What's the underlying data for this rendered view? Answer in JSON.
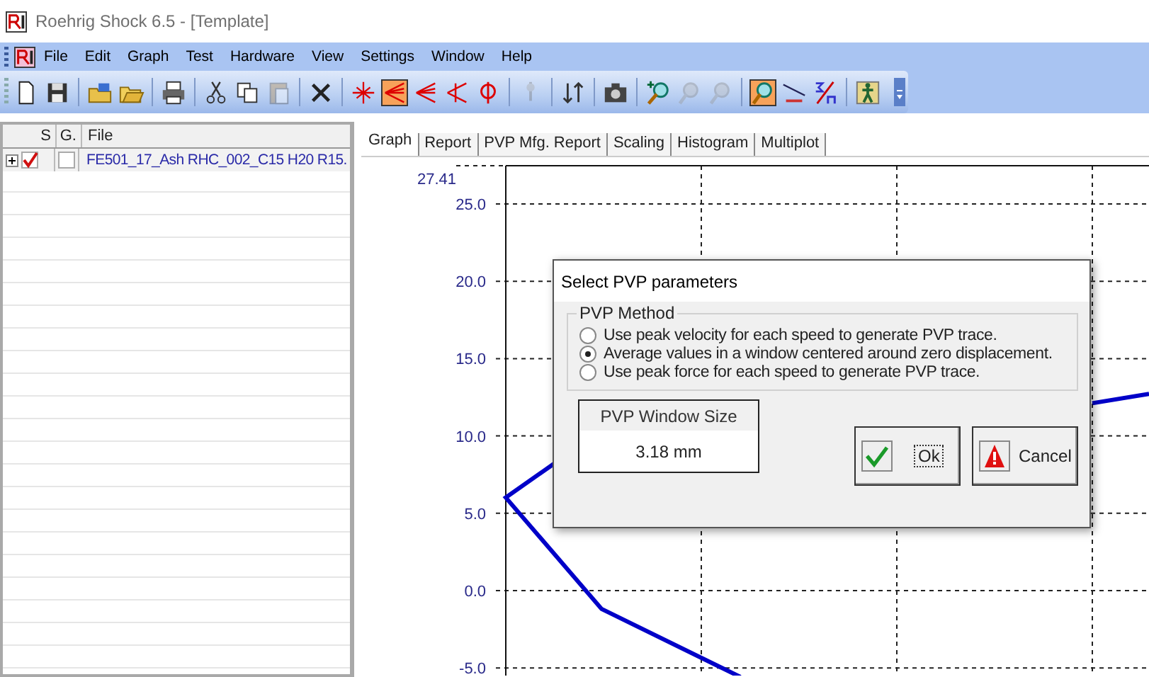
{
  "window": {
    "title": "Roehrig Shock 6.5 - [Template]"
  },
  "menu": [
    "File",
    "Edit",
    "Graph",
    "Test",
    "Hardware",
    "View",
    "Settings",
    "Window",
    "Help"
  ],
  "toolbar": [
    {
      "buttons": [
        {
          "kind": "new",
          "selected": false,
          "disabled": false
        },
        {
          "kind": "save",
          "selected": false,
          "disabled": false
        }
      ]
    },
    {
      "buttons": [
        {
          "kind": "open-database",
          "selected": false,
          "disabled": false
        },
        {
          "kind": "open-folder",
          "selected": false,
          "disabled": false
        }
      ]
    },
    {
      "buttons": [
        {
          "kind": "print",
          "selected": false,
          "disabled": false
        }
      ]
    },
    {
      "buttons": [
        {
          "kind": "cut",
          "selected": false,
          "disabled": false
        },
        {
          "kind": "copy",
          "selected": false,
          "disabled": false
        },
        {
          "kind": "paste",
          "selected": false,
          "disabled": true
        }
      ]
    },
    {
      "buttons": [
        {
          "kind": "delete",
          "selected": false,
          "disabled": false
        }
      ]
    },
    {
      "buttons": [
        {
          "kind": "crosshair",
          "selected": false,
          "disabled": false
        },
        {
          "kind": "lines-box",
          "selected": true,
          "disabled": false
        },
        {
          "kind": "lines-left",
          "selected": false,
          "disabled": false
        },
        {
          "kind": "lines-right",
          "selected": false,
          "disabled": false
        },
        {
          "kind": "phi",
          "selected": false,
          "disabled": false
        }
      ]
    },
    {
      "buttons": [
        {
          "kind": "marker",
          "selected": false,
          "disabled": true
        }
      ]
    },
    {
      "buttons": [
        {
          "kind": "sort",
          "selected": false,
          "disabled": false
        }
      ]
    },
    {
      "buttons": [
        {
          "kind": "camera",
          "selected": false,
          "disabled": false
        }
      ]
    },
    {
      "buttons": [
        {
          "kind": "zoom-in",
          "selected": false,
          "disabled": false
        },
        {
          "kind": "zoom-key",
          "selected": false,
          "disabled": true
        },
        {
          "kind": "zoom-round",
          "selected": false,
          "disabled": true
        }
      ]
    },
    {
      "buttons": [
        {
          "kind": "zoom",
          "selected": true,
          "disabled": false
        },
        {
          "kind": "yx-line",
          "selected": false,
          "disabled": false
        },
        {
          "kind": "sigma",
          "selected": false,
          "disabled": false
        }
      ]
    },
    {
      "buttons": [
        {
          "kind": "figure",
          "selected": false,
          "disabled": false
        }
      ]
    }
  ],
  "file_list": {
    "columns": [
      "S",
      "G.",
      "File"
    ],
    "rows": [
      {
        "expanded": false,
        "s_checked": true,
        "g_checked": false,
        "file": "FE501_17_Ash RHC_002_C15 H20 R15."
      }
    ]
  },
  "tabs": [
    {
      "label": "Graph",
      "selected": true
    },
    {
      "label": "Report",
      "selected": false
    },
    {
      "label": "PVP Mfg. Report",
      "selected": false
    },
    {
      "label": "Scaling",
      "selected": false
    },
    {
      "label": "Histogram",
      "selected": false
    },
    {
      "label": "Multiplot",
      "selected": false
    }
  ],
  "graph": {
    "axis_max_label": "27.41",
    "y_labels": [
      "25.0",
      "20.0",
      "15.0",
      "10.0",
      "5.0",
      "0.0",
      "-5.0"
    ]
  },
  "dialog": {
    "title": "Select PVP parameters",
    "group_label": "PVP Method",
    "options": [
      {
        "label": "Use peak velocity for each speed to generate PVP trace.",
        "selected": false
      },
      {
        "label": "Average values in a window centered around zero displacement.",
        "selected": true
      },
      {
        "label": "Use peak force for each speed to generate PVP trace.",
        "selected": false
      }
    ],
    "window_size": {
      "label": "PVP Window Size",
      "value": "3.18 mm"
    },
    "buttons": [
      {
        "kind": "ok",
        "label": "Ok"
      },
      {
        "kind": "cancel",
        "label": "Cancel"
      }
    ]
  }
}
